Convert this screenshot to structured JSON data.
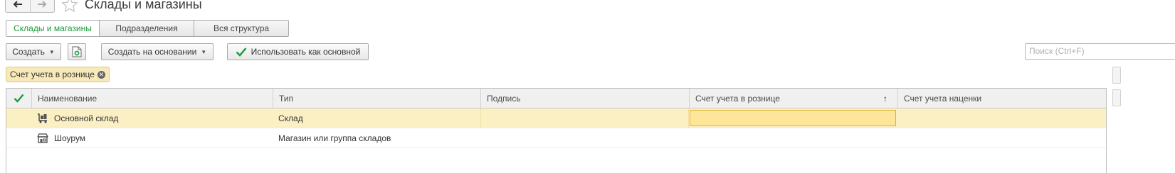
{
  "header": {
    "title": "Склады и магазины",
    "back_icon": "arrow-left-icon",
    "forward_icon": "arrow-right-icon",
    "favorite_icon": "star-outline-icon"
  },
  "tabs": [
    {
      "label": "Склады и магазины",
      "active": true
    },
    {
      "label": "Подразделения",
      "active": false
    },
    {
      "label": "Вся структура",
      "active": false
    }
  ],
  "toolbar": {
    "create_label": "Создать",
    "copy_icon": "add-document-icon",
    "create_based_label": "Создать на основании",
    "use_as_main_label": "Использовать как основной",
    "search_placeholder": "Поиск (Ctrl+F)"
  },
  "filter": {
    "chip_label": "Счет учета в рознице"
  },
  "table": {
    "columns": [
      "Наименование",
      "Тип",
      "Подпись",
      "Счет учета в рознице",
      "Счет учета наценки"
    ],
    "sorted_column": "Счет учета в рознице",
    "sort_direction": "ascending",
    "rows": [
      {
        "name": "Основной склад",
        "type": "Склад",
        "signature": "",
        "retail_account": "",
        "markup_account": "",
        "icon": "warehouse-cart-icon",
        "selected": true
      },
      {
        "name": "Шоурум",
        "type": "Магазин или группа складов",
        "signature": "",
        "retail_account": "",
        "markup_account": "",
        "icon": "store-icon",
        "selected": false
      }
    ]
  },
  "colors": {
    "accent_green": "#1c9a3a",
    "selected_row": "#fbefc4",
    "focused_cell": "#fde59a",
    "filter_chip": "#f7e9b8"
  }
}
